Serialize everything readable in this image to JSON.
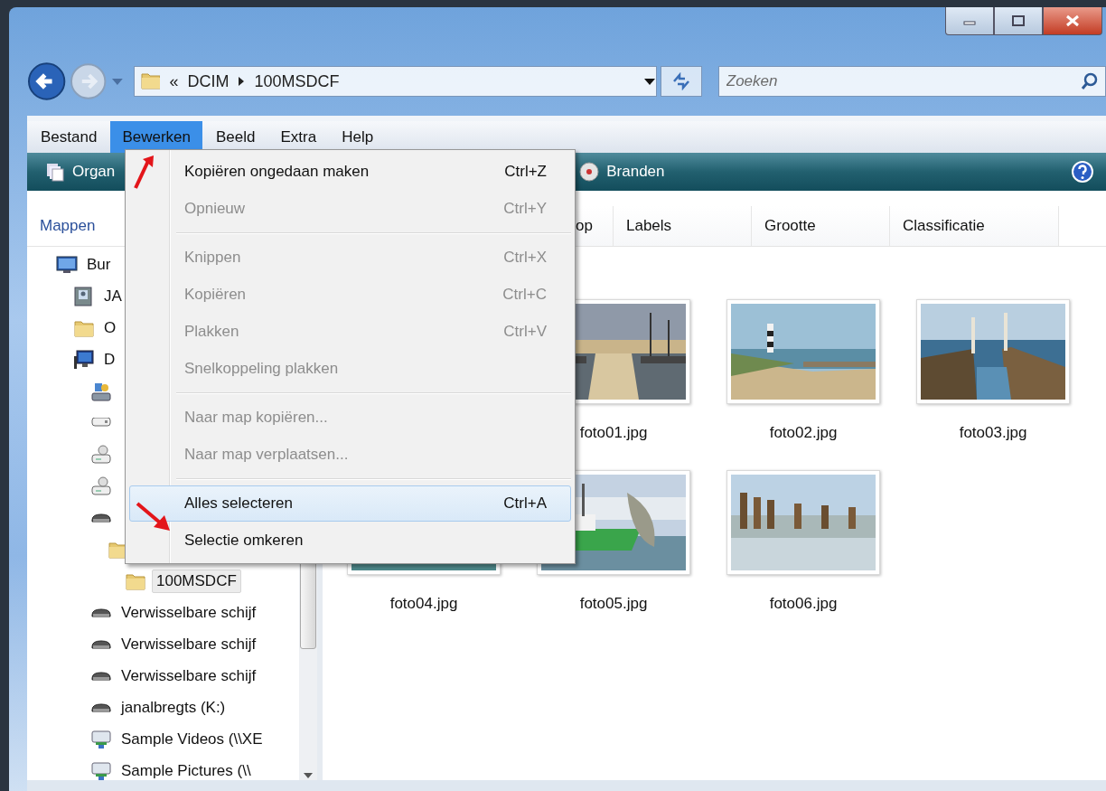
{
  "address": {
    "prefix": "«",
    "path": [
      "DCIM",
      "100MSDCF"
    ]
  },
  "search": {
    "placeholder": "Zoeken"
  },
  "menu_bar": [
    {
      "label": "Bestand",
      "selected": false
    },
    {
      "label": "Bewerken",
      "selected": true
    },
    {
      "label": "Beeld",
      "selected": false
    },
    {
      "label": "Extra",
      "selected": false
    },
    {
      "label": "Help",
      "selected": false
    }
  ],
  "command_bar": [
    {
      "label": "Organ",
      "kind": "organize"
    },
    {
      "label": "Branden",
      "kind": "burn"
    }
  ],
  "folder_pane": {
    "title": "Mappen",
    "tree": [
      {
        "label": "Bur",
        "kind": "desktop",
        "selected": false,
        "children": [
          {
            "label": "JA",
            "kind": "contact",
            "selected": false
          },
          {
            "label": "O",
            "kind": "folder",
            "selected": false
          },
          {
            "label": "D",
            "kind": "computer",
            "selected": false,
            "children": [
              {
                "kind": "control-panel",
                "selected": false
              },
              {
                "kind": "drive",
                "selected": false
              },
              {
                "kind": "network-drive",
                "selected": false
              },
              {
                "kind": "network-drive",
                "selected": false
              },
              {
                "kind": "removable",
                "selected": false,
                "children": [
                  {
                    "kind": "folder",
                    "selected": false,
                    "children": [
                      {
                        "label": "100MSDCF",
                        "kind": "folder",
                        "selected": true
                      }
                    ]
                  }
                ]
              },
              {
                "label": "Verwisselbare schijf",
                "kind": "removable",
                "selected": false
              },
              {
                "label": "Verwisselbare schijf",
                "kind": "removable",
                "selected": false
              },
              {
                "label": "Verwisselbare schijf",
                "kind": "removable",
                "selected": false
              },
              {
                "label": "janalbregts (K:)",
                "kind": "removable",
                "selected": false
              },
              {
                "label": "Sample Videos (\\\\XE",
                "kind": "network-share",
                "selected": false
              },
              {
                "label": "Sample Pictures (\\\\",
                "kind": "network-share",
                "selected": false
              }
            ]
          }
        ]
      }
    ]
  },
  "columns": [
    "op",
    "Labels",
    "Grootte",
    "Classificatie"
  ],
  "files": [
    {
      "name": "foto01.jpg",
      "kind": "picture"
    },
    {
      "name": "foto02.jpg",
      "kind": "picture"
    },
    {
      "name": "foto03.jpg",
      "kind": "picture"
    },
    {
      "name": "foto04.jpg",
      "kind": "picture"
    },
    {
      "name": "foto05.jpg",
      "kind": "picture"
    },
    {
      "name": "foto06.jpg",
      "kind": "picture"
    }
  ],
  "edit_menu": {
    "groups": [
      [
        {
          "label": "Kopiëren ongedaan maken",
          "shortcut": "Ctrl+Z",
          "disabled": false,
          "selected": false
        },
        {
          "label": "Opnieuw",
          "shortcut": "Ctrl+Y",
          "disabled": true,
          "selected": false
        }
      ],
      [
        {
          "label": "Knippen",
          "shortcut": "Ctrl+X",
          "disabled": true,
          "selected": false
        },
        {
          "label": "Kopiëren",
          "shortcut": "Ctrl+C",
          "disabled": true,
          "selected": false
        },
        {
          "label": "Plakken",
          "shortcut": "Ctrl+V",
          "disabled": true,
          "selected": false
        },
        {
          "label": "Snelkoppeling plakken",
          "disabled": true,
          "selected": false
        }
      ],
      [
        {
          "label": "Naar map kopiëren...",
          "disabled": true,
          "selected": false
        },
        {
          "label": "Naar map verplaatsen...",
          "disabled": true,
          "selected": false
        }
      ],
      [
        {
          "label": "Alles selecteren",
          "shortcut": "Ctrl+A",
          "disabled": false,
          "selected": true
        },
        {
          "label": "Selectie omkeren",
          "disabled": false,
          "selected": false
        }
      ]
    ]
  }
}
